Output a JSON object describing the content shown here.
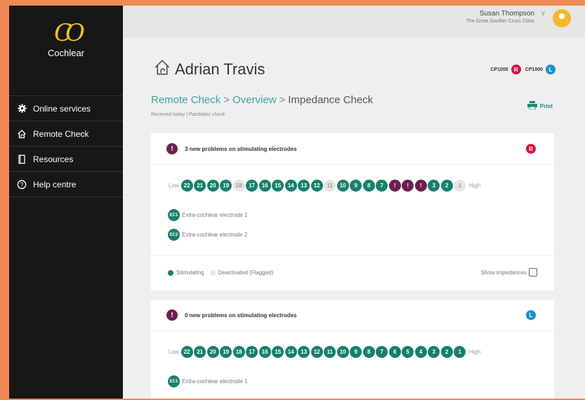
{
  "brand": {
    "name": "Cochlear",
    "mark": "CO"
  },
  "user": {
    "name": "Susan Thompson",
    "clinic": "The Great Souther Cross Clinic"
  },
  "nav": [
    {
      "label": "Online services",
      "icon": "gear-icon"
    },
    {
      "label": "Remote Check",
      "icon": "home-ear-icon"
    },
    {
      "label": "Resources",
      "icon": "book-icon"
    },
    {
      "label": "Help centre",
      "icon": "question-icon"
    }
  ],
  "patient": {
    "name": "Adrian Travis"
  },
  "devices": [
    {
      "model": "CP1000",
      "side": "R"
    },
    {
      "model": "CP1000",
      "side": "L"
    }
  ],
  "breadcrumb": {
    "part1": "Remote Check",
    "part2": "Overview",
    "part3": "Impedance Check",
    "sep": ">"
  },
  "subtext": "Received today | Paediatric check",
  "print_label": "Print",
  "cards": [
    {
      "title": "3 new problems on stimulating electrodes",
      "side": "R",
      "alert": "!",
      "low": "Low",
      "high": "High",
      "electrodes": [
        {
          "label": "22",
          "state": "on"
        },
        {
          "label": "21",
          "state": "on"
        },
        {
          "label": "20",
          "state": "on"
        },
        {
          "label": "19",
          "state": "on"
        },
        {
          "label": "18",
          "state": "off"
        },
        {
          "label": "17",
          "state": "on"
        },
        {
          "label": "16",
          "state": "on"
        },
        {
          "label": "15",
          "state": "on"
        },
        {
          "label": "14",
          "state": "on"
        },
        {
          "label": "13",
          "state": "on"
        },
        {
          "label": "12",
          "state": "on"
        },
        {
          "label": "11",
          "state": "off"
        },
        {
          "label": "10",
          "state": "on"
        },
        {
          "label": "9",
          "state": "on"
        },
        {
          "label": "8",
          "state": "on"
        },
        {
          "label": "7",
          "state": "on"
        },
        {
          "label": "!",
          "state": "flag"
        },
        {
          "label": "!",
          "state": "flag"
        },
        {
          "label": "!",
          "state": "flag"
        },
        {
          "label": "3",
          "state": "on"
        },
        {
          "label": "2",
          "state": "on"
        },
        {
          "label": "1",
          "state": "off"
        }
      ],
      "ec": [
        {
          "badge": "EC1",
          "label": "Extra-cochlear electrode 1"
        },
        {
          "badge": "EC2",
          "label": "Extra-cochlear electrode 2"
        }
      ],
      "legend": {
        "stimulating": "Stimulating",
        "deactivated": "Deactivated (Flagged)",
        "show": "Show impedances"
      }
    },
    {
      "title": "0 new problems on stimulating electrodes",
      "side": "L",
      "alert": "!",
      "low": "Low",
      "high": "High",
      "electrodes": [
        {
          "label": "22",
          "state": "on"
        },
        {
          "label": "21",
          "state": "on"
        },
        {
          "label": "20",
          "state": "on"
        },
        {
          "label": "19",
          "state": "on"
        },
        {
          "label": "18",
          "state": "on"
        },
        {
          "label": "17",
          "state": "on"
        },
        {
          "label": "16",
          "state": "on"
        },
        {
          "label": "15",
          "state": "on"
        },
        {
          "label": "14",
          "state": "on"
        },
        {
          "label": "13",
          "state": "on"
        },
        {
          "label": "12",
          "state": "on"
        },
        {
          "label": "11",
          "state": "on"
        },
        {
          "label": "10",
          "state": "on"
        },
        {
          "label": "9",
          "state": "on"
        },
        {
          "label": "8",
          "state": "on"
        },
        {
          "label": "7",
          "state": "on"
        },
        {
          "label": "6",
          "state": "on"
        },
        {
          "label": "5",
          "state": "on"
        },
        {
          "label": "4",
          "state": "on"
        },
        {
          "label": "3",
          "state": "on"
        },
        {
          "label": "2",
          "state": "on"
        },
        {
          "label": "1",
          "state": "on"
        }
      ],
      "ec": [
        {
          "badge": "EC1",
          "label": "Extra-cochlear electrode 1"
        }
      ]
    }
  ],
  "colors": {
    "accent": "#3aa69a",
    "electrode_on": "#17806c",
    "flag": "#6d1f4e",
    "right": "#d6163f",
    "left": "#1f8fce",
    "sidebar": "#171717"
  }
}
